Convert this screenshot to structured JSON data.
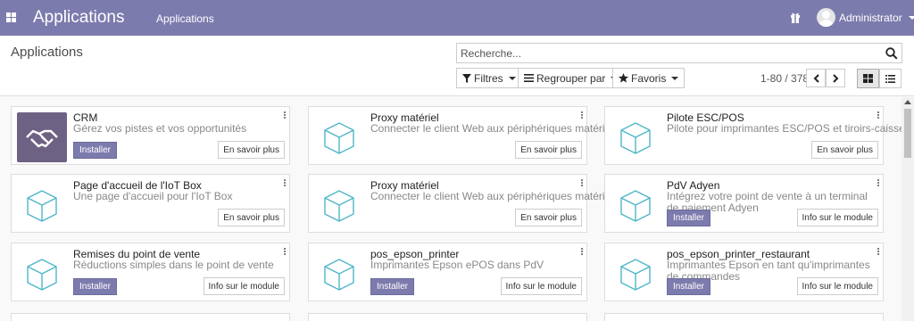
{
  "navbar": {
    "brand": "Applications",
    "menu": "Applications",
    "user": "Administrator",
    "color": "#7c7bad"
  },
  "control_panel": {
    "breadcrumb": "Applications",
    "search_placeholder": "Recherche...",
    "filters_label": "Filtres",
    "group_by_label": "Regrouper par",
    "favorites_label": "Favoris",
    "pager": "1-80 / 378"
  },
  "icons": {
    "apps": "apps-grid-icon",
    "gift": "gift-icon",
    "search": "search-icon",
    "filter": "filter-icon",
    "group": "list-group-icon",
    "star": "star-icon",
    "prev": "chevron-left-icon",
    "next": "chevron-right-icon",
    "kanban": "kanban-view-icon",
    "list": "list-view-icon",
    "module": "cube-icon",
    "crm": "handshake-icon"
  },
  "cards": [
    {
      "title": "CRM",
      "description": "Gérez vos pistes et vos opportunités",
      "primary_button": "Installer",
      "secondary_button": "En savoir plus"
    },
    {
      "title": "Proxy matériel",
      "description": "Connecter le client Web aux périphériques matériels",
      "primary_button": "",
      "secondary_button": "En savoir plus"
    },
    {
      "title": "Pilote ESC/POS",
      "description": "Pilote pour imprimantes ESC/POS et tiroirs-caisse",
      "primary_button": "",
      "secondary_button": "En savoir plus"
    },
    {
      "title": "Page d'accueil de l'IoT Box",
      "description": "Une page d'accueil pour l'IoT Box",
      "primary_button": "",
      "secondary_button": "En savoir plus"
    },
    {
      "title": "Proxy matériel",
      "description": "Connecter le client Web aux périphériques matériels",
      "primary_button": "",
      "secondary_button": "En savoir plus"
    },
    {
      "title": "PdV Adyen",
      "description": "Intégrez votre point de vente à un terminal de paiement Adyen",
      "primary_button": "Installer",
      "secondary_button": "Info sur le module"
    },
    {
      "title": "Remises du point de vente",
      "description": "Réductions simples dans le point de vente",
      "primary_button": "Installer",
      "secondary_button": "Info sur le module"
    },
    {
      "title": "pos_epson_printer",
      "description": "Imprimantes Epson ePOS dans PdV",
      "primary_button": "Installer",
      "secondary_button": "Info sur le module"
    },
    {
      "title": "pos_epson_printer_restaurant",
      "description": "Imprimantes Epson en tant qu'imprimantes de commandes",
      "primary_button": "Installer",
      "secondary_button": "Info sur le module"
    }
  ]
}
